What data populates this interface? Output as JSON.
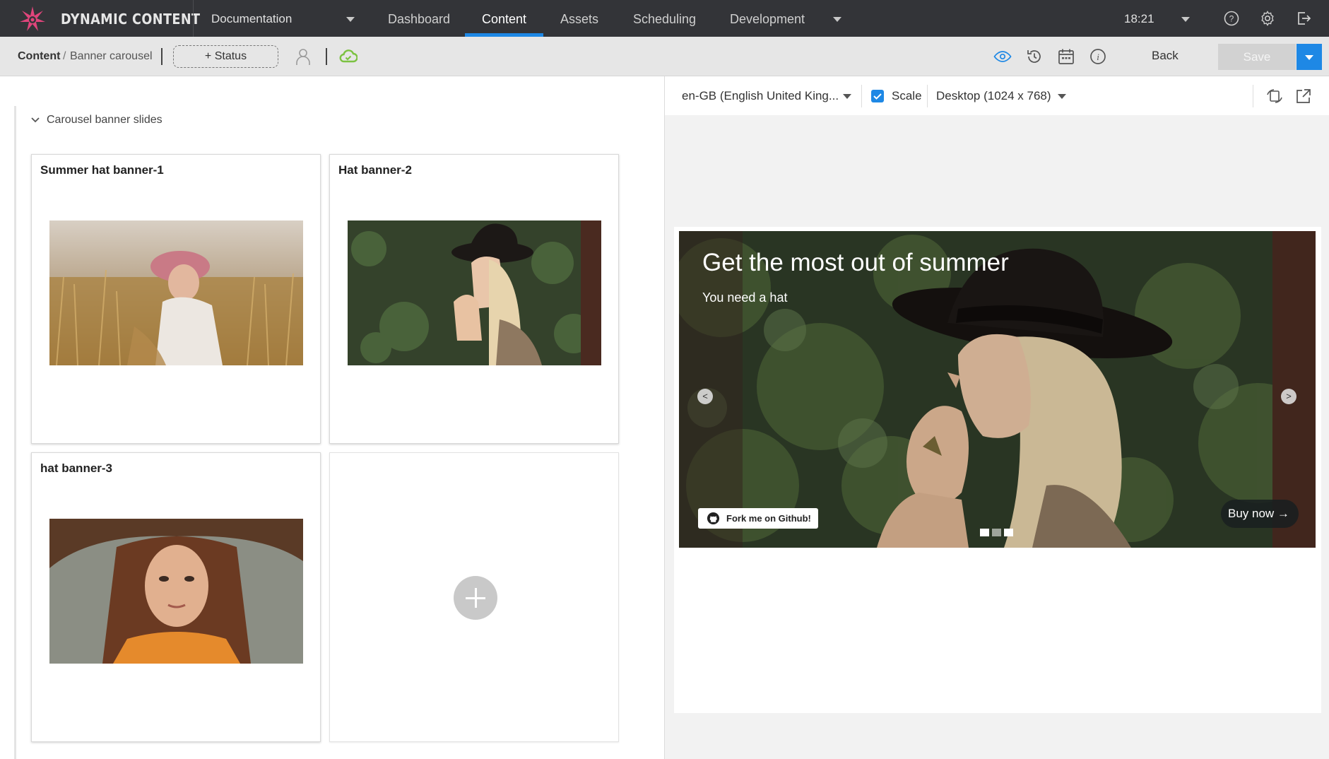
{
  "nav": {
    "brand": "DYNAMIC CONTENT",
    "hub": "Documentation",
    "tabs": [
      "Dashboard",
      "Content",
      "Assets",
      "Scheduling",
      "Development"
    ],
    "active_tab": "Content",
    "time": "18:21"
  },
  "toolbar": {
    "breadcrumb_root": "Content",
    "breadcrumb_sep": "/",
    "breadcrumb_page": "Banner carousel",
    "status_label": "+ Status",
    "back_label": "Back",
    "save_label": "Save",
    "accent": "#1e88e5",
    "sync_color": "#7cc242"
  },
  "editor": {
    "section_title": "Carousel banner slides",
    "cards": [
      {
        "title": "Summer hat banner-1"
      },
      {
        "title": "Hat banner-2"
      },
      {
        "title": "hat banner-3"
      }
    ]
  },
  "preview": {
    "locale": "en-GB (English United King...",
    "scale_label": "Scale",
    "scale_checked": true,
    "device": "Desktop (1024 x 768)",
    "banner": {
      "headline": "Get the most out of summer",
      "subtext": "You need a hat",
      "prev_label": "<",
      "next_label": ">",
      "github_label": "Fork me on Github!",
      "cta_label": "Buy now →",
      "slides_total": 3,
      "active_slide": 1
    }
  }
}
